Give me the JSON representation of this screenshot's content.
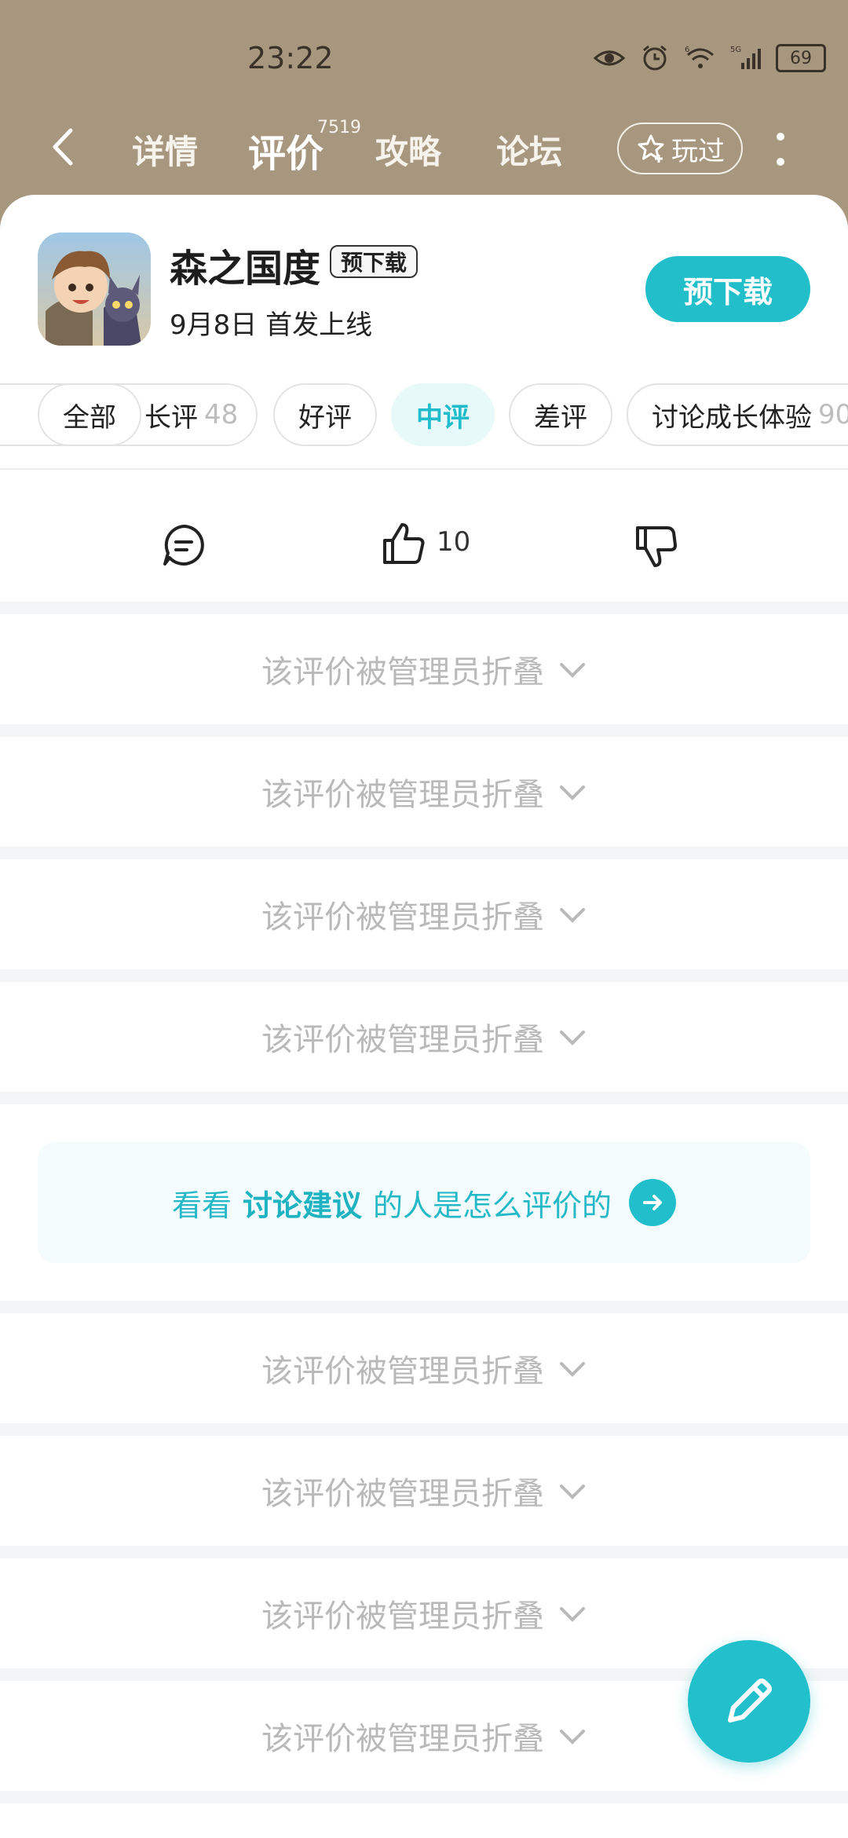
{
  "status_bar": {
    "time": "23:22",
    "battery": "69",
    "network": "5G",
    "wifi_badge": "6",
    "icons": [
      "eye-icon",
      "alarm-icon",
      "wifi-icon",
      "signal-icon",
      "battery-icon"
    ]
  },
  "nav": {
    "tabs": [
      {
        "label": "详情"
      },
      {
        "label": "评价",
        "badge": "7519",
        "active": true
      },
      {
        "label": "攻略"
      },
      {
        "label": "论坛"
      }
    ],
    "played_label": "玩过"
  },
  "game": {
    "title": "森之国度",
    "tag": "预下载",
    "date": "9月8日 首发上线",
    "action_label": "预下载"
  },
  "filters": [
    {
      "label": "全部"
    },
    {
      "label": "长评",
      "count": "48"
    },
    {
      "label": "好评"
    },
    {
      "label": "中评",
      "active": true
    },
    {
      "label": "差评"
    },
    {
      "label": "讨论成长体验",
      "count": "90"
    }
  ],
  "review_actions": {
    "like_count": "10"
  },
  "folded": {
    "text": "该评价被管理员折叠"
  },
  "promo": {
    "prefix": "看看",
    "highlight": "讨论建议",
    "suffix": "的人是怎么评价的"
  },
  "colors": {
    "accent": "#22bfcb",
    "header_bg": "#a8977f"
  }
}
